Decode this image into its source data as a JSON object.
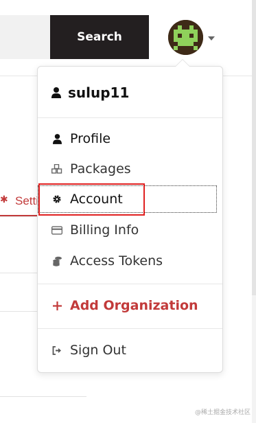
{
  "header": {
    "search_button_label": "Search"
  },
  "user_menu": {
    "username": "sulup11",
    "items": [
      {
        "label": "Profile",
        "icon": "user-icon"
      },
      {
        "label": "Packages",
        "icon": "cubes-icon"
      },
      {
        "label": "Account",
        "icon": "gear-icon"
      },
      {
        "label": "Billing Info",
        "icon": "credit-card-icon"
      },
      {
        "label": "Access Tokens",
        "icon": "coins-icon"
      }
    ],
    "add_organization_label": "Add Organization",
    "sign_out_label": "Sign Out"
  },
  "background": {
    "tab_label": "Settings"
  },
  "watermark": "@稀土掘金技术社区",
  "colors": {
    "accent": "#c23a3a",
    "search_button": "#231f20",
    "highlight": "#e02020"
  }
}
